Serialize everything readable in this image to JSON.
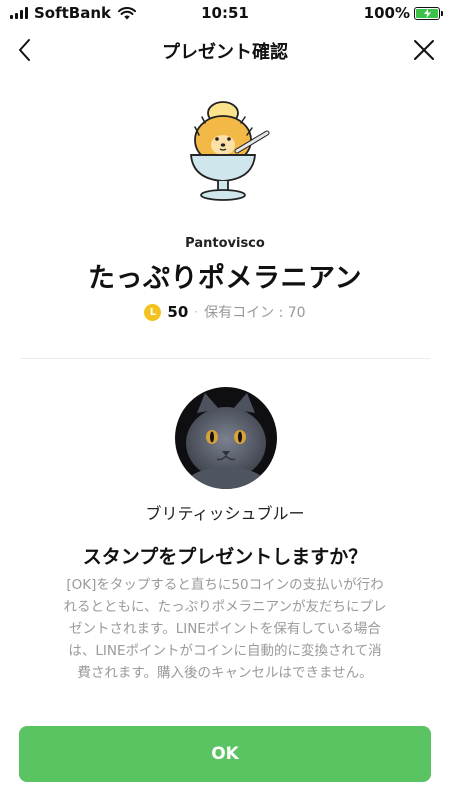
{
  "status_bar": {
    "carrier": "SoftBank",
    "time": "10:51",
    "battery_percent": "100%",
    "battery_level": 1.0
  },
  "nav": {
    "title": "プレゼント確認",
    "back_icon": "chevron-left-icon",
    "close_icon": "close-icon"
  },
  "sticker": {
    "creator": "Pantovisco",
    "name": "たっぷりポメラニアン",
    "coin_symbol": "L",
    "price": "50",
    "separator": "·",
    "owned_coins": "保有コイン : 70"
  },
  "recipient": {
    "name": "ブリティッシュブルー"
  },
  "confirm": {
    "question": "スタンプをプレゼントしますか？",
    "description": "[OK]をタップすると直ちに50コインの支払いが行われるとともに、たっぷりポメラニアンが友だちにプレゼントされます。LINEポイントを保有している場合は、LINEポイントがコインに自動的に変換されて消費されます。購入後のキャンセルはできません。",
    "ok_label": "OK"
  },
  "colors": {
    "ok_button": "#5ac463",
    "coin": "#f2c21f",
    "muted_text": "#9a9a9a"
  }
}
